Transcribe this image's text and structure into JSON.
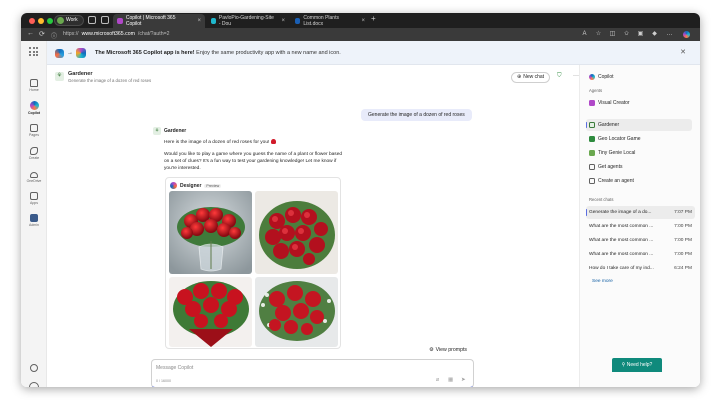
{
  "browser": {
    "profile": "Work",
    "tabs": [
      {
        "label": "Copilot | Microsoft 365 Copilot",
        "active": true,
        "fav_color": "#b048c8"
      },
      {
        "label": "PavloPio-Gardening-Site - Dou",
        "active": false,
        "fav_color": "#1fb8cd"
      },
      {
        "label": "Common Plants List.docx",
        "active": false,
        "fav_color": "#1a5fb4"
      }
    ],
    "url_prefix": "https://",
    "url_host": "www.microsoft365.com",
    "url_path": "/chat/?auth=2"
  },
  "rail": {
    "items": [
      {
        "label": "Home",
        "icon": "home-icon"
      },
      {
        "label": "Copilot",
        "icon": "copilot-icon"
      },
      {
        "label": "Pages",
        "icon": "pages-icon"
      },
      {
        "label": "Create",
        "icon": "create-icon"
      },
      {
        "label": "OneDrive",
        "icon": "onedrive-icon"
      },
      {
        "label": "Apps",
        "icon": "apps-icon"
      },
      {
        "label": "Admin",
        "icon": "admin-icon"
      }
    ]
  },
  "banner": {
    "bold": "The Microsoft 365 Copilot app is here!",
    "text": " Enjoy the same productivity app with a new name and icon."
  },
  "header": {
    "agent_name": "Gardener",
    "agent_subtitle": "Generate the image of a dozen of red roses",
    "new_chat": "New chat"
  },
  "conversation": {
    "user_message": "Generate the image of a dozen of red roses",
    "bot_name": "Gardener",
    "bot_line1": "Here is the image of a dozen of red roses for you!",
    "bot_line2": "Would you like to play a game where you guess the name of a plant or flower based on a set of clues? It's a fun way to test your gardening knowledge! Let me know if you're interested.",
    "designer_label": "Designer",
    "preview_badge": "Preview",
    "view_prompts": "View prompts"
  },
  "composer": {
    "placeholder": "Message Copilot",
    "char_count": "0 / 16000"
  },
  "right_panel": {
    "copilot_label": "Copilot",
    "agents_heading": "Agents",
    "agents": [
      {
        "label": "Visual Creator",
        "color": "#b048c8"
      },
      {
        "label": "Gardener",
        "color": "#3a7a3a",
        "selected": true
      },
      {
        "label": "Geo Locator Game",
        "color": "#2e8b3e"
      },
      {
        "label": "Tiny Genie Local",
        "color": "#3a7a3a"
      },
      {
        "label": "Get agents",
        "color": "#616161"
      },
      {
        "label": "Create an agent",
        "color": "#616161"
      }
    ],
    "recent_heading": "Recent chats",
    "recent": [
      {
        "title": "Generate the image of a do...",
        "time": "7:07 PM",
        "selected": true
      },
      {
        "title": "What are the most common ...",
        "time": "7:00 PM"
      },
      {
        "title": "What are the most common ...",
        "time": "7:00 PM"
      },
      {
        "title": "What are the most common ...",
        "time": "7:00 PM"
      },
      {
        "title": "How do I take care of my ind...",
        "time": "6:24 PM"
      }
    ],
    "see_more": "See more"
  },
  "need_help": "Need help?"
}
